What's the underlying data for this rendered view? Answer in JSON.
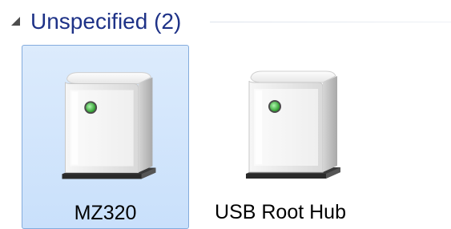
{
  "group": {
    "title": "Unspecified (2)",
    "expanded": true,
    "arrow_icon": "collapse-arrow-icon"
  },
  "devices": [
    {
      "label": "MZ320",
      "selected": true,
      "icon": "device-tower-icon",
      "status_light": "#3fb93f"
    },
    {
      "label": "USB Root Hub",
      "selected": false,
      "icon": "device-tower-icon",
      "status_light": "#3fb93f"
    }
  ],
  "colors": {
    "group_title": "#1e3287",
    "selection_fill": "#cfe3fc",
    "selection_border": "#84acdd"
  }
}
